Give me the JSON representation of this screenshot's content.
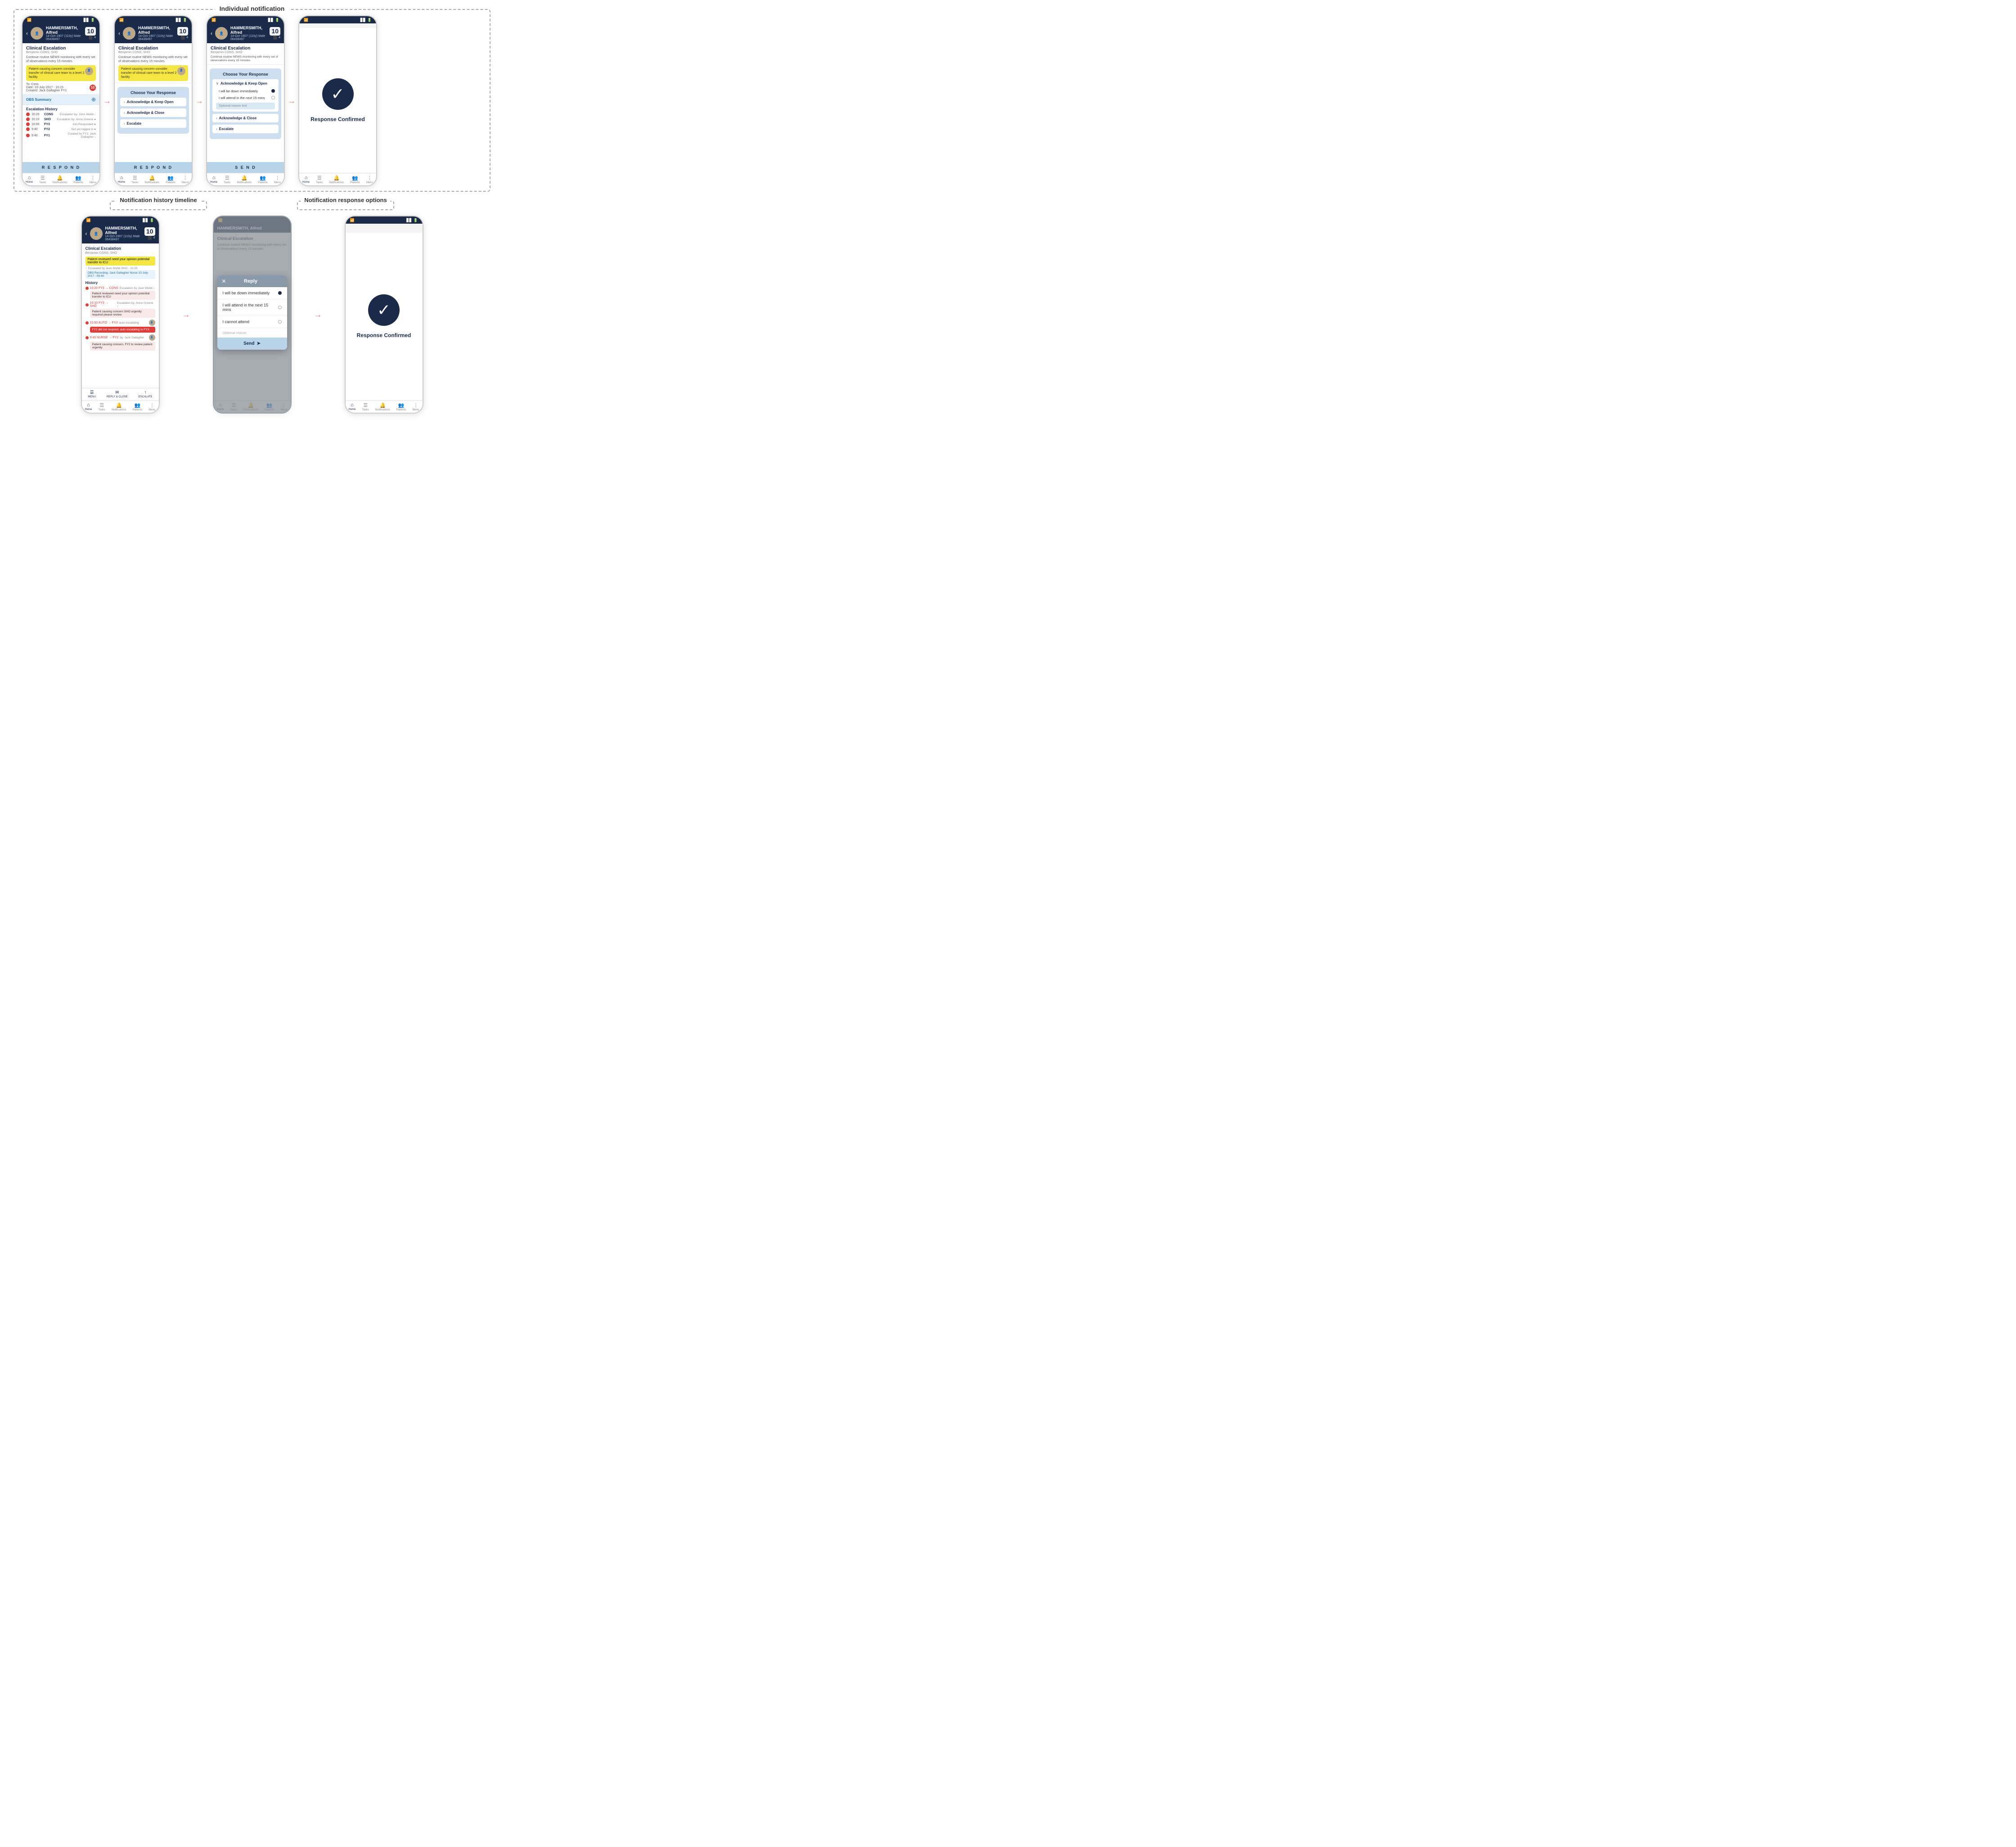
{
  "top_label": "Individual notification",
  "bottom_left_label": "Notification history timeline",
  "bottom_right_label": "Notification response options",
  "patient": {
    "name": "HAMMERSMITH, Alfred",
    "dob": "14-Oct-1907 (110y)",
    "gender": "Male",
    "id": "06438497",
    "badge": "10",
    "badge_sub": "4"
  },
  "clinical_escalation": {
    "title": "Clinical Escalation",
    "subtitle": "Benjamin CONS, SHO",
    "body": "Continue routine NEWS monitoring with every set of observations every 15 minutes",
    "yellow_card": "Patient causing concern consider transfer of clinical care team to a level 2 facility",
    "to_label": "To: Cons",
    "date_label": "Date: 10-July-2017 - 10:15",
    "created_label": "Created: Jack Gallagher FY1"
  },
  "obs_summary_label": "OBS Summary",
  "escalation_history": {
    "title": "Escalation History",
    "rows": [
      {
        "time": "10:20",
        "role": "CONS",
        "detail": "Escalation by: John Webb ↓"
      },
      {
        "time": "10:10",
        "role": "SHO",
        "detail": "Escalation by: Anna Greene ●"
      },
      {
        "time": "10:00",
        "role": "FY3",
        "detail": "Into Responded ●"
      },
      {
        "time": "9:40",
        "role": "FY2",
        "detail": "Not yet logged in ●"
      },
      {
        "time": "9:40",
        "role": "FY1",
        "detail": "Created by FY1: Jack Gallagher ↓"
      }
    ]
  },
  "respond_label": "R E S P O N D",
  "send_label": "S E N D",
  "choose_response": {
    "title": "Choose Your Response",
    "options": [
      {
        "label": "Acknowledge & Keep Open",
        "type": "expandable"
      },
      {
        "label": "Acknowledge & Close",
        "type": "simple"
      },
      {
        "label": "Escalate",
        "type": "simple"
      }
    ],
    "sub_options": [
      {
        "label": "I will be down immediately",
        "selected": true
      },
      {
        "label": "I will attend in the next 15 mins",
        "selected": false
      }
    ],
    "reason_placeholder": "Optional reason text"
  },
  "confirmed": {
    "text": "Response Confirmed"
  },
  "reply": {
    "title": "Reply",
    "options": [
      {
        "label": "I will be down immediately",
        "selected": true
      },
      {
        "label": "I will attend in the next 15 mins",
        "selected": false
      },
      {
        "label": "I cannot attend",
        "selected": false
      }
    ],
    "reason_placeholder": "Optional reason",
    "send_label": "Send"
  },
  "nav": {
    "items": [
      "Home",
      "Tasks",
      "Notifications",
      "Patients",
      "Menu"
    ]
  },
  "timeline": {
    "yellow_card": "Patient reviewed need your opinion potential transfer to ICU",
    "escalated_by": "Escalated by Jean Webb SHO - 10:20",
    "obs_recording": "OBS Recording: Jack Gallagher Nurse  10-July-2017 - 09:40",
    "history_title": "History",
    "entries": [
      {
        "time": "10:20",
        "from": "FY3",
        "to": "CONS",
        "by": "by: Jean Webb ↓",
        "card": "Patient reviewed need your opinion potential transfer to ICU"
      },
      {
        "time": "10:10",
        "from": "FY3",
        "to": "SHO",
        "by": "Escalation by: Anna Greene ↓",
        "card": "Patient causing concern SHO urgently required please review."
      },
      {
        "time": "10:00",
        "from": "AUTO",
        "to": "FY3",
        "by": "auto escalating",
        "card": "FY2 did not respond, auto escalating to FY3.",
        "auto": true
      },
      {
        "time": "9:40",
        "from": "NURSE",
        "to": "FY2",
        "by": "by: Jack Gallagher",
        "card": "Patient causing concern, FY2 to review patient urgently"
      }
    ]
  },
  "bottom_actions": [
    "MENU",
    "REPLY & CLOSE",
    "ESCALATE"
  ]
}
